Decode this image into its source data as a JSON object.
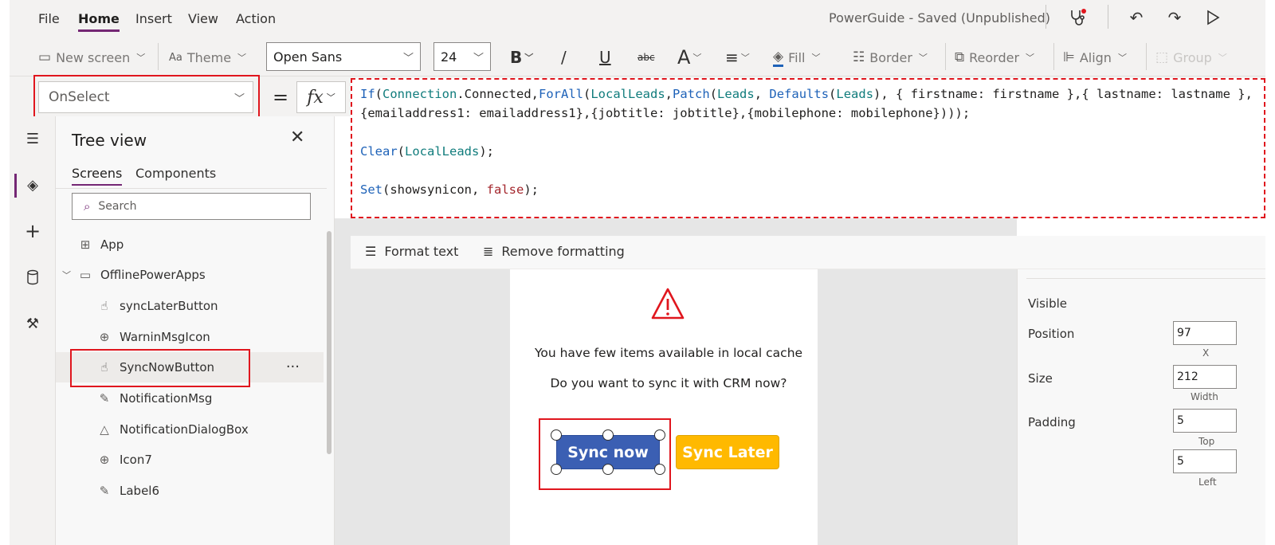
{
  "menu": {
    "items": [
      "File",
      "Home",
      "Insert",
      "View",
      "Action"
    ],
    "active": "Home",
    "app_title": "PowerGuide - Saved (Unpublished)"
  },
  "ribbon": {
    "new_screen": "New screen",
    "theme": "Theme",
    "font_family": "Open Sans",
    "font_size": "24",
    "bold": "B",
    "italic": "/",
    "underline": "U",
    "strike": "abc",
    "font_color": "A",
    "fill": "Fill",
    "border": "Border",
    "reorder": "Reorder",
    "align": "Align",
    "group": "Group"
  },
  "formula": {
    "property": "OnSelect",
    "equals": "=",
    "fx": "fx",
    "line1_tokens": [
      {
        "t": "If",
        "c": "c-fn"
      },
      {
        "t": "(",
        "c": "c-p"
      },
      {
        "t": "Connection",
        "c": "c-tb"
      },
      {
        "t": ".Connected,",
        "c": "c-p"
      },
      {
        "t": "ForAll",
        "c": "c-fn"
      },
      {
        "t": "(",
        "c": "c-p"
      },
      {
        "t": "LocalLeads",
        "c": "c-tb"
      },
      {
        "t": ",",
        "c": "c-p"
      },
      {
        "t": "Patch",
        "c": "c-fn"
      },
      {
        "t": "(",
        "c": "c-p"
      },
      {
        "t": "Leads",
        "c": "c-tb"
      },
      {
        "t": ", ",
        "c": "c-p"
      },
      {
        "t": "Defaults",
        "c": "c-fn"
      },
      {
        "t": "(",
        "c": "c-p"
      },
      {
        "t": "Leads",
        "c": "c-tb"
      },
      {
        "t": "), { firstname: firstname },{ lastname: lastname },{emailaddress1: emailaddress1},{jobtitle: jobtitle},{mobilephone: mobilephone})));",
        "c": "c-p"
      }
    ],
    "line2_tokens": [
      {
        "t": "Clear",
        "c": "c-fn"
      },
      {
        "t": "(",
        "c": "c-p"
      },
      {
        "t": "LocalLeads",
        "c": "c-tb"
      },
      {
        "t": ");",
        "c": "c-p"
      }
    ],
    "line3_tokens": [
      {
        "t": "Set",
        "c": "c-fn"
      },
      {
        "t": "(showsynicon, ",
        "c": "c-p"
      },
      {
        "t": "false",
        "c": "c-kw"
      },
      {
        "t": ");",
        "c": "c-p"
      }
    ]
  },
  "format_bar": {
    "format_text": "Format text",
    "remove_formatting": "Remove formatting"
  },
  "tree_view": {
    "title": "Tree view",
    "tabs": [
      "Screens",
      "Components"
    ],
    "active_tab": "Screens",
    "search_placeholder": "Search",
    "nodes": [
      {
        "label": "App",
        "icon": "app-icon",
        "glyph": "⊞",
        "level": 0
      },
      {
        "label": "OfflinePowerApps",
        "icon": "screen-icon",
        "glyph": "▭",
        "level": 0,
        "expanded": true
      },
      {
        "label": "syncLaterButton",
        "icon": "button-icon",
        "glyph": "☝",
        "level": 1
      },
      {
        "label": "WarninMsgIcon",
        "icon": "icons-icon",
        "glyph": "⊕",
        "level": 1
      },
      {
        "label": "SyncNowButton",
        "icon": "button-icon",
        "glyph": "☝",
        "level": 1,
        "selected": true
      },
      {
        "label": "NotificationMsg",
        "icon": "label-icon",
        "glyph": "✎",
        "level": 1
      },
      {
        "label": "NotificationDialogBox",
        "icon": "shapes-icon",
        "glyph": "△",
        "level": 1
      },
      {
        "label": "Icon7",
        "icon": "icons-icon",
        "glyph": "⊕",
        "level": 1
      },
      {
        "label": "Label6",
        "icon": "label-icon",
        "glyph": "✎",
        "level": 1
      }
    ],
    "more": "···"
  },
  "canvas": {
    "message1": "You have few items available in local cache",
    "message2": "Do you want to sync it with CRM now?",
    "sync_now": "Sync now",
    "sync_later": "Sync Later"
  },
  "properties": {
    "visible_label": "Visible",
    "position_label": "Position",
    "position_x": "97",
    "x_label": "X",
    "size_label": "Size",
    "size_width": "212",
    "width_label": "Width",
    "padding_label": "Padding",
    "padding_top": "5",
    "top_label": "Top",
    "padding_left": "5",
    "left_label": "Left"
  },
  "colors": {
    "accent": "#742774",
    "highlight": "#e0161e",
    "sync_now_bg": "#3b5fb3",
    "sync_later_bg": "#ffb900"
  }
}
